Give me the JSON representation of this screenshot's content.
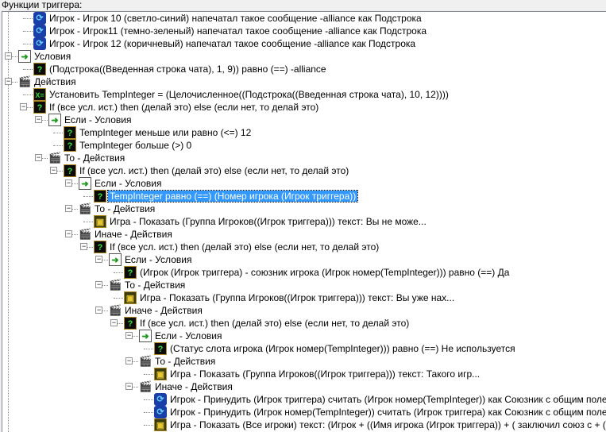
{
  "header": {
    "title": "Функции триггера:"
  },
  "rows": [
    {
      "level": 1,
      "icon": "event",
      "text": "Игрок - Игрок 10 (светло-синий) напечатал такое сообщение -alliance как Подстрока"
    },
    {
      "level": 1,
      "icon": "event",
      "text": "Игрок - Игрок11 (темно-зеленый) напечатал такое сообщение -alliance как Подстрока"
    },
    {
      "level": 1,
      "icon": "event",
      "text": "Игрок - Игрок 12 (коричневый) напечатал такое сообщение -alliance как Подстрока"
    },
    {
      "level": 0,
      "icon": "cond",
      "text": "Условия",
      "exp": true
    },
    {
      "level": 1,
      "icon": "q",
      "text": "(Подстрока((Введенная строка чата), 1, 9)) равно (==) -alliance"
    },
    {
      "level": 0,
      "icon": "act",
      "text": "Действия",
      "exp": true
    },
    {
      "level": 1,
      "icon": "set",
      "text": "Установить TempInteger = (Целочисленное((Подстрока((Введенная строка чата), 10, 12))))"
    },
    {
      "level": 1,
      "icon": "q",
      "text": "If (все усл. ист.) then (делай это) else (если нет, то делай это)",
      "exp": true
    },
    {
      "level": 2,
      "icon": "cond",
      "text": "Если - Условия",
      "exp": true
    },
    {
      "level": 3,
      "icon": "q",
      "text": "TempInteger меньше или равно (<=) 12"
    },
    {
      "level": 3,
      "icon": "q",
      "text": "TempInteger больше (>) 0"
    },
    {
      "level": 2,
      "icon": "act",
      "text": "То - Действия",
      "exp": true
    },
    {
      "level": 3,
      "icon": "q",
      "text": "If (все усл. ист.) then (делай это) else (если нет, то делай это)",
      "exp": true
    },
    {
      "level": 4,
      "icon": "cond",
      "text": "Если - Условия",
      "exp": true
    },
    {
      "level": 5,
      "icon": "q",
      "text": "TempInteger равно (==) (Номер игрока (Игрок триггера))",
      "selected": true
    },
    {
      "level": 4,
      "icon": "act",
      "text": "То - Действия",
      "exp": true
    },
    {
      "level": 5,
      "icon": "game",
      "text": "Игра - Показать (Группа Игроков((Игрок триггера))) текст: Вы не може..."
    },
    {
      "level": 4,
      "icon": "act",
      "text": "Иначе - Действия",
      "exp": true
    },
    {
      "level": 5,
      "icon": "q",
      "text": "If (все усл. ист.) then (делай это) else (если нет, то делай это)",
      "exp": true
    },
    {
      "level": 6,
      "icon": "cond",
      "text": "Если - Условия",
      "exp": true
    },
    {
      "level": 7,
      "icon": "q",
      "text": "(Игрок (Игрок триггера) - союзник игрока (Игрок номер(TempInteger))) равно (==) Да"
    },
    {
      "level": 6,
      "icon": "act",
      "text": "То - Действия",
      "exp": true
    },
    {
      "level": 7,
      "icon": "game",
      "text": "Игра - Показать (Группа Игроков((Игрок триггера))) текст: Вы уже нах..."
    },
    {
      "level": 6,
      "icon": "act",
      "text": "Иначе - Действия",
      "exp": true
    },
    {
      "level": 7,
      "icon": "q",
      "text": "If (все усл. ист.) then (делай это) else (если нет, то делай это)",
      "exp": true
    },
    {
      "level": 8,
      "icon": "cond",
      "text": "Если - Условия",
      "exp": true
    },
    {
      "level": 9,
      "icon": "q",
      "text": "(Статус слота игрока (Игрок номер(TempInteger))) равно (==) Не используется"
    },
    {
      "level": 8,
      "icon": "act",
      "text": "То - Действия",
      "exp": true
    },
    {
      "level": 9,
      "icon": "game",
      "text": "Игра - Показать (Группа Игроков((Игрок триггера))) текст: Такого игр..."
    },
    {
      "level": 8,
      "icon": "act",
      "text": "Иначе - Действия",
      "exp": true
    },
    {
      "level": 9,
      "icon": "event",
      "text": "Игрок - Принудить (Игрок триггера) считать (Игрок номер(TempInteger)) как Союзник с общим полем зрения"
    },
    {
      "level": 9,
      "icon": "event",
      "text": "Игрок - Принудить (Игрок номер(TempInteger)) считать (Игрок триггера) как Союзник с общим полем зрения"
    },
    {
      "level": 9,
      "icon": "game",
      "text": "Игра - Показать (Все игроки) текст: (Игрок  + ((Имя игрока (Игрок триггера)) + ( заключил союз с  + (Имя игрока"
    }
  ],
  "icons": {
    "event": "⟳",
    "cond": "➜",
    "act": "🎬",
    "q": "?",
    "set": "X=",
    "game": "▣"
  }
}
